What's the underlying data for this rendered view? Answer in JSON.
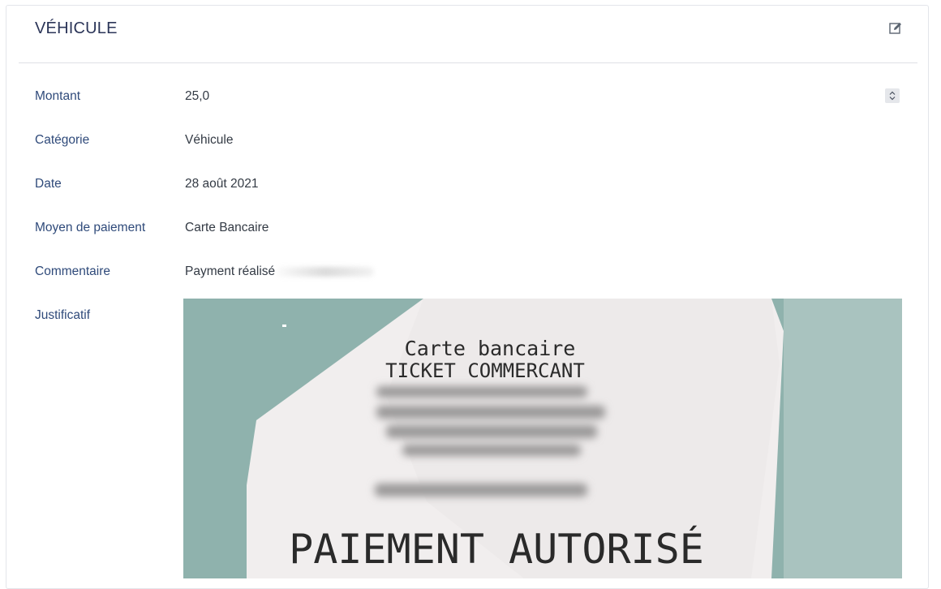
{
  "card": {
    "title": "VÉHICULE",
    "edit_icon": "edit-icon"
  },
  "fields": {
    "montant": {
      "label": "Montant",
      "value": "25,0"
    },
    "categorie": {
      "label": "Catégorie",
      "value": "Véhicule"
    },
    "date": {
      "label": "Date",
      "value": "28 août 2021"
    },
    "moyen": {
      "label": "Moyen de paiement",
      "value": "Carte Bancaire"
    },
    "commentaire": {
      "label": "Commentaire",
      "value": "Payment réalisé"
    },
    "justificatif": {
      "label": "Justificatif"
    }
  },
  "receipt": {
    "line1": "Carte bancaire",
    "line2": "TICKET COMMERCANT",
    "status": "PAIEMENT AUTORISÉ"
  },
  "colors": {
    "label": "#2f4a7a",
    "title": "#2b3558",
    "value": "#333a44",
    "receipt_background": "#8fb0ab"
  }
}
